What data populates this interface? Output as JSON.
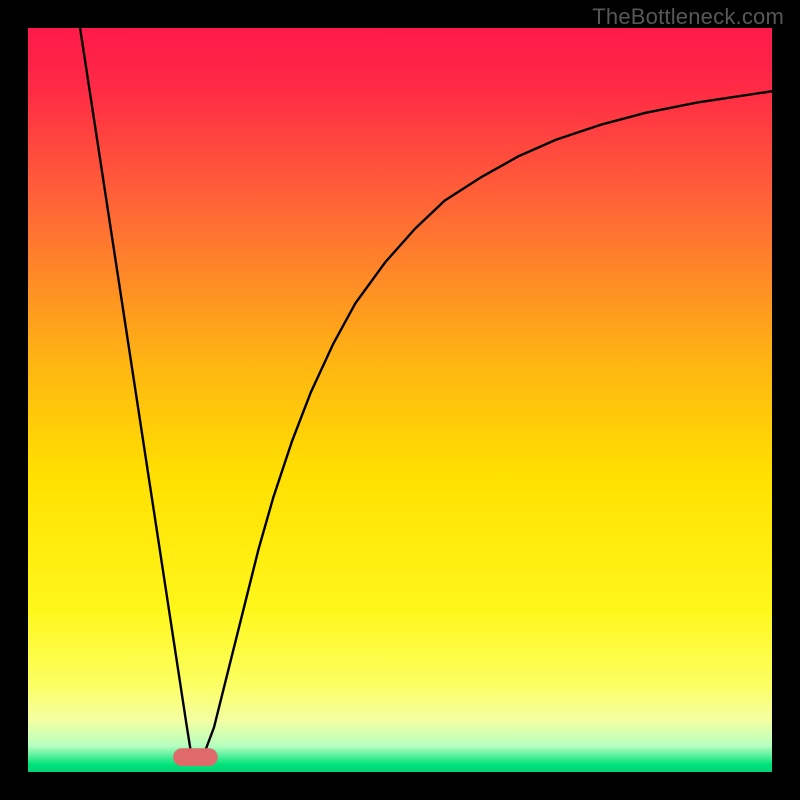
{
  "watermark": "TheBottleneck.com",
  "chart_data": {
    "type": "line",
    "title": "",
    "xlabel": "",
    "ylabel": "",
    "xlim": [
      0,
      100
    ],
    "ylim": [
      0,
      100
    ],
    "background_gradient": {
      "stops": [
        {
          "offset": 0.0,
          "color": "#ff1a4a"
        },
        {
          "offset": 0.08,
          "color": "#ff2a45"
        },
        {
          "offset": 0.25,
          "color": "#ff6a35"
        },
        {
          "offset": 0.45,
          "color": "#ffb512"
        },
        {
          "offset": 0.6,
          "color": "#ffe000"
        },
        {
          "offset": 0.78,
          "color": "#fff71a"
        },
        {
          "offset": 0.88,
          "color": "#fcff60"
        },
        {
          "offset": 0.93,
          "color": "#f4ffa1"
        },
        {
          "offset": 0.965,
          "color": "#b6ffc0"
        },
        {
          "offset": 0.99,
          "color": "#00e37a"
        },
        {
          "offset": 1.0,
          "color": "#00d27a"
        }
      ]
    },
    "curve_color": "#000000",
    "marker": {
      "x": 22.5,
      "y": 2.0,
      "w": 6.0,
      "h": 2.4,
      "rx": 1.2,
      "color": "#e06a6a"
    },
    "series": [
      {
        "name": "curve",
        "points": [
          {
            "x": 7.0,
            "y": 100.0
          },
          {
            "x": 8.1,
            "y": 92.8
          },
          {
            "x": 9.2,
            "y": 85.6
          },
          {
            "x": 10.3,
            "y": 78.4
          },
          {
            "x": 11.4,
            "y": 71.2
          },
          {
            "x": 12.5,
            "y": 64.0
          },
          {
            "x": 13.6,
            "y": 56.8
          },
          {
            "x": 14.7,
            "y": 49.6
          },
          {
            "x": 15.8,
            "y": 42.4
          },
          {
            "x": 16.9,
            "y": 35.2
          },
          {
            "x": 18.0,
            "y": 28.0
          },
          {
            "x": 19.1,
            "y": 20.8
          },
          {
            "x": 20.2,
            "y": 13.6
          },
          {
            "x": 21.3,
            "y": 6.4
          },
          {
            "x": 22.0,
            "y": 2.0
          },
          {
            "x": 22.5,
            "y": 1.6
          },
          {
            "x": 23.5,
            "y": 2.0
          },
          {
            "x": 25.0,
            "y": 6.0
          },
          {
            "x": 27.0,
            "y": 14.0
          },
          {
            "x": 29.0,
            "y": 22.0
          },
          {
            "x": 31.0,
            "y": 30.0
          },
          {
            "x": 33.0,
            "y": 37.0
          },
          {
            "x": 35.5,
            "y": 44.5
          },
          {
            "x": 38.0,
            "y": 51.0
          },
          {
            "x": 41.0,
            "y": 57.5
          },
          {
            "x": 44.0,
            "y": 63.0
          },
          {
            "x": 48.0,
            "y": 68.5
          },
          {
            "x": 52.0,
            "y": 73.0
          },
          {
            "x": 56.0,
            "y": 76.8
          },
          {
            "x": 61.0,
            "y": 80.0
          },
          {
            "x": 66.0,
            "y": 82.8
          },
          {
            "x": 71.0,
            "y": 85.0
          },
          {
            "x": 77.0,
            "y": 87.0
          },
          {
            "x": 83.0,
            "y": 88.6
          },
          {
            "x": 90.0,
            "y": 90.0
          },
          {
            "x": 100.0,
            "y": 91.5
          }
        ]
      }
    ]
  }
}
